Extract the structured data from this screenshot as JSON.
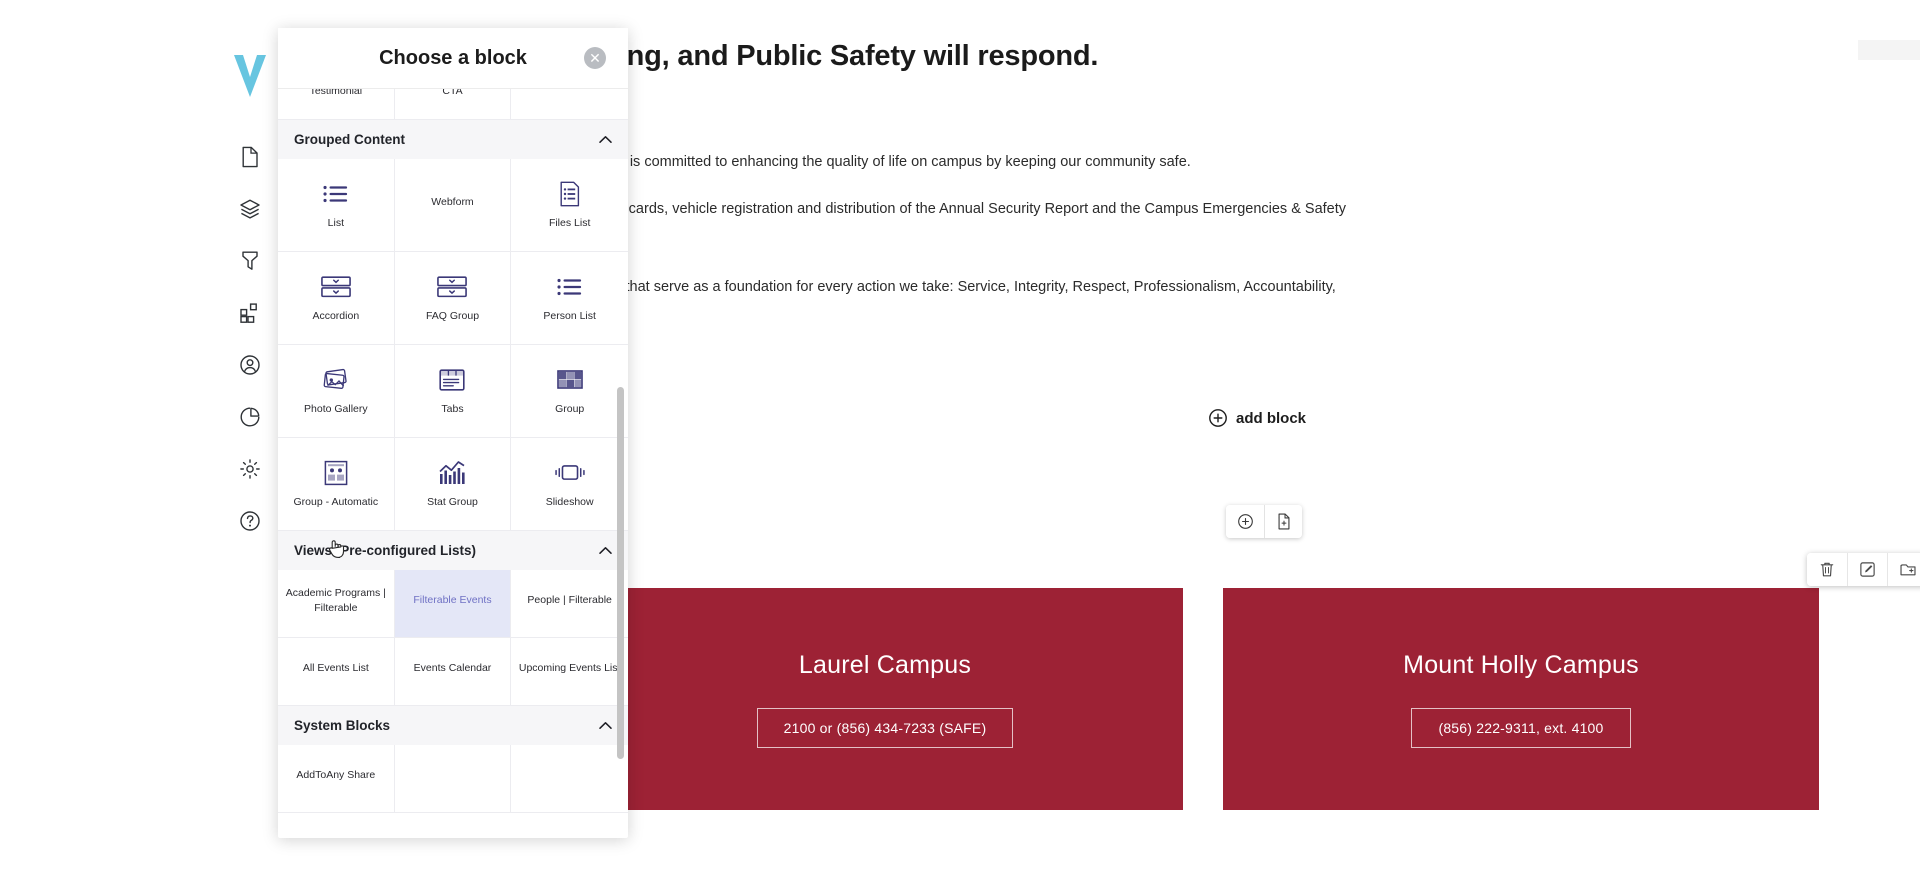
{
  "app": {
    "logo_name": "v-logo",
    "rail_icons": [
      {
        "name": "page-icon",
        "title": "Pages"
      },
      {
        "name": "layers-icon",
        "title": "Layouts"
      },
      {
        "name": "tag-icon",
        "title": "Tags"
      },
      {
        "name": "blocks-icon",
        "title": "Blocks"
      },
      {
        "name": "user-circle-icon",
        "title": "People"
      },
      {
        "name": "pie-chart-icon",
        "title": "Analytics"
      },
      {
        "name": "gear-icon",
        "title": "Settings"
      },
      {
        "name": "help-circle-icon",
        "title": "Help"
      }
    ]
  },
  "modal": {
    "title": "Choose a block",
    "close_label": "✕",
    "sections": [
      {
        "id": "partial-top",
        "label": "",
        "chevron": "",
        "tiles": [
          {
            "label": "Testimonial",
            "icon": "testimonial-icon"
          },
          {
            "label": "CTA",
            "icon": "cta-icon"
          },
          {
            "label": "",
            "icon": ""
          }
        ]
      },
      {
        "id": "grouped-content",
        "label": "Grouped Content",
        "chevron": "⌃",
        "tiles": [
          {
            "label": "List",
            "icon": "list-icon"
          },
          {
            "label": "Webform",
            "icon": ""
          },
          {
            "label": "Files List",
            "icon": "files-list-icon"
          },
          {
            "label": "Accordion",
            "icon": "accordion-icon"
          },
          {
            "label": "FAQ Group",
            "icon": "faq-group-icon"
          },
          {
            "label": "Person List",
            "icon": "person-list-icon"
          },
          {
            "label": "Photo Gallery",
            "icon": "photo-gallery-icon"
          },
          {
            "label": "Tabs",
            "icon": "tabs-icon"
          },
          {
            "label": "Group",
            "icon": "group-icon"
          },
          {
            "label": "Group - Automatic",
            "icon": "group-automatic-icon"
          },
          {
            "label": "Stat Group",
            "icon": "stat-group-icon"
          },
          {
            "label": "Slideshow",
            "icon": "slideshow-icon"
          }
        ]
      },
      {
        "id": "views",
        "label": "Views (Pre-configured Lists)",
        "chevron": "⌃",
        "tiles": [
          {
            "label": "Academic Programs | Filterable",
            "icon": ""
          },
          {
            "label": "Filterable Events",
            "icon": "",
            "selected": true
          },
          {
            "label": "People | Filterable",
            "icon": ""
          },
          {
            "label": "All Events List",
            "icon": ""
          },
          {
            "label": "Events Calendar",
            "icon": ""
          },
          {
            "label": "Upcoming Events List",
            "icon": ""
          }
        ]
      },
      {
        "id": "system-blocks",
        "label": "System Blocks",
        "chevron": "⌃",
        "tiles": [
          {
            "label": "AddToAny Share",
            "icon": ""
          }
        ]
      }
    ]
  },
  "page": {
    "hero_title": "g, say something, and Public Safety will respond.",
    "paragraph_1": "nty's Public Safety Department is committed to enhancing the quality of life on campus by keeping our community safe.",
    "paragraph_2": "fety violations/fines, student ID cards, vehicle registration and distribution of the Annual Security Report and the Campus Emergencies & Safety",
    "paragraph_3": "guided by the following values that serve as a foundation for every action we take: Service, Integrity, Respect, Professionalism, Accountability,",
    "add_block_label": "add block",
    "mini_toolbar": [
      {
        "name": "add-circle-icon",
        "title": "Add block"
      },
      {
        "name": "add-page-icon",
        "title": "Add page"
      }
    ],
    "block_toolbar": [
      {
        "name": "trash-icon",
        "title": "Delete block"
      },
      {
        "name": "edit-pencil-icon",
        "title": "Edit block"
      },
      {
        "name": "folder-add-icon",
        "title": "Move block"
      }
    ],
    "cards": [
      {
        "title": "Laurel Campus",
        "button": "2100 or (856) 434-7233 (SAFE)"
      },
      {
        "title": "Mount Holly Campus",
        "button": "(856) 222-9311, ext. 4100"
      }
    ],
    "card_color": "#9d2235"
  },
  "colors": {
    "accent_purple": "#3b3878",
    "selected_bg": "#e4e7f7",
    "selected_text": "#6f71c4",
    "card_red": "#9d2235",
    "logo_blue": "#67c5e0"
  }
}
